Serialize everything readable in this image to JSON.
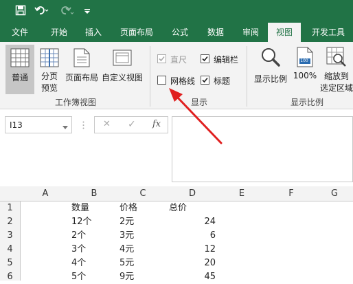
{
  "quick_access": {
    "icons": [
      "save-icon",
      "undo-icon",
      "redo-icon",
      "customize-icon"
    ]
  },
  "tabs": [
    {
      "label": "文件",
      "active": false
    },
    {
      "label": "开始",
      "active": false
    },
    {
      "label": "插入",
      "active": false
    },
    {
      "label": "页面布局",
      "active": false
    },
    {
      "label": "公式",
      "active": false
    },
    {
      "label": "数据",
      "active": false
    },
    {
      "label": "审阅",
      "active": false
    },
    {
      "label": "视图",
      "active": true
    },
    {
      "label": "开发工具",
      "active": false
    }
  ],
  "ribbon": {
    "workbook_views": {
      "group_label": "工作簿视图",
      "normal": "普通",
      "page_break_1": "分页",
      "page_break_2": "预览",
      "page_layout": "页面布局",
      "custom_views": "自定义视图"
    },
    "show": {
      "group_label": "显示",
      "ruler": {
        "label": "直尺",
        "checked": true,
        "disabled": true
      },
      "formula_bar": {
        "label": "编辑栏",
        "checked": true
      },
      "gridlines": {
        "label": "网格线",
        "checked": false
      },
      "headings": {
        "label": "标题",
        "checked": true
      }
    },
    "zoom": {
      "group_label": "显示比例",
      "zoom": "显示比例",
      "hundred": "100%",
      "zoom_sel_1": "缩放到",
      "zoom_sel_2": "选定区域",
      "icon_badge": "100"
    }
  },
  "formula_bar": {
    "name_box": "I13",
    "cancel": "✕",
    "enter": "✓",
    "fx": "fx",
    "formula": ""
  },
  "grid": {
    "columns": [
      "A",
      "B",
      "C",
      "D",
      "E",
      "F",
      "G"
    ],
    "rows": [
      "1",
      "2",
      "3",
      "4",
      "5",
      "6"
    ],
    "header_row": [
      "数量",
      "价格",
      "总价"
    ],
    "data": [
      [
        "12个",
        "2元",
        "24"
      ],
      [
        "2个",
        "3元",
        "6"
      ],
      [
        "3个",
        "4元",
        "12"
      ],
      [
        "4个",
        "5元",
        "20"
      ],
      [
        "5个",
        "9元",
        "45"
      ]
    ]
  },
  "colors": {
    "accent": "#217346",
    "arrow": "#e02020"
  }
}
